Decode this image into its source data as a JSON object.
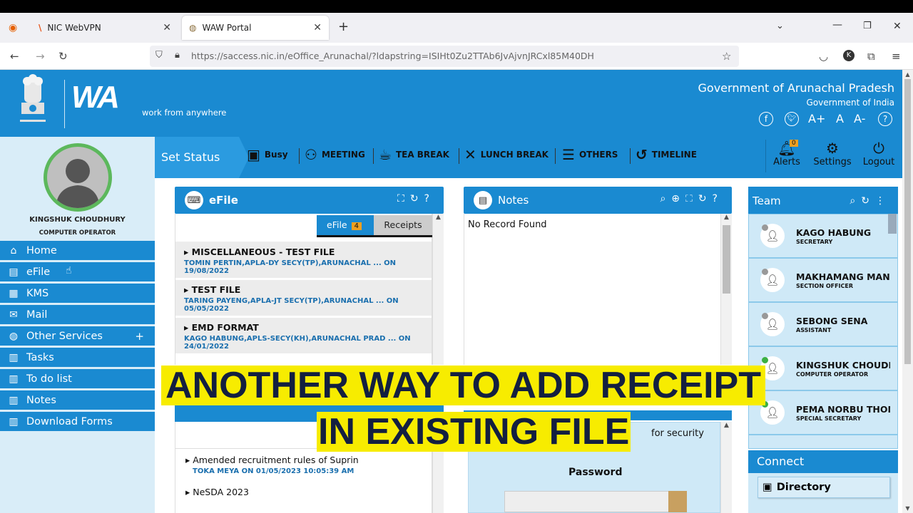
{
  "browser": {
    "tabs": [
      {
        "label": "NIC WebVPN",
        "close": "✕"
      },
      {
        "label": "WAW Portal",
        "close": "✕"
      }
    ],
    "new_tab": "+",
    "url": "https://saccess.nic.in/eOffice_Arunachal/?ldapstring=ISIHt0Zu2TTAb6JvAjvnJRCxl85M40DH",
    "profile_initial": "K"
  },
  "header": {
    "logo_text": "WA",
    "tagline": "work from anywhere",
    "gov_line1": "Government of Arunachal Pradesh",
    "gov_line2": "Government of India",
    "font_controls": [
      "A+",
      "A",
      "A-"
    ],
    "help": "?"
  },
  "user": {
    "name": "KINGSHUK CHOUDHURY",
    "role": "COMPUTER OPERATOR",
    "status_color": "#5cb85c"
  },
  "sidebar": {
    "items": [
      {
        "label": "Home",
        "icon": "home-icon"
      },
      {
        "label": "eFile",
        "icon": "efile-icon"
      },
      {
        "label": "KMS",
        "icon": "kms-icon"
      },
      {
        "label": "Mail",
        "icon": "mail-icon"
      },
      {
        "label": "Other Services",
        "icon": "globe-icon",
        "expand": "+"
      },
      {
        "label": "Tasks",
        "icon": "tasks-icon"
      },
      {
        "label": "To do list",
        "icon": "todo-icon"
      },
      {
        "label": "Notes",
        "icon": "notes-icon"
      },
      {
        "label": "Download Forms",
        "icon": "download-icon"
      }
    ]
  },
  "status": {
    "set_status": "Set Status",
    "options": [
      {
        "label": "Busy",
        "icon": "monitor-icon"
      },
      {
        "label": "MEETING",
        "icon": "meeting-icon"
      },
      {
        "label": "TEA BREAK",
        "icon": "tea-icon"
      },
      {
        "label": "LUNCH BREAK",
        "icon": "cutlery-icon"
      },
      {
        "label": "OTHERS",
        "icon": "list-icon"
      },
      {
        "label": "TIMELINE",
        "icon": "history-icon"
      }
    ],
    "alerts": {
      "label": "Alerts",
      "count": "0"
    },
    "settings": "Settings",
    "logout": "Logout"
  },
  "efile": {
    "title": "eFile",
    "tabs": [
      {
        "label": "eFile",
        "count": "4"
      },
      {
        "label": "Receipts"
      }
    ],
    "files": [
      {
        "title": "MISCELLANEOUS - TEST FILE",
        "sub": "TOMIN PERTIN,APLA-DY SECY(TP),ARUNACHAL ... ON 19/08/2022"
      },
      {
        "title": "TEST FILE",
        "sub": "TARING PAYENG,APLA-JT SECY(TP),ARUNACHAL ... ON 05/05/2022"
      },
      {
        "title": "EMD FORMAT",
        "sub": "KAGO HABUNG,APLS-SECY(KH),ARUNACHAL PRAD ... ON 24/01/2022"
      }
    ]
  },
  "lower_list": {
    "items": [
      {
        "title": "Amended recruitment rules of Suprin",
        "sub": "TOKA MEYA ON 01/05/2023 10:05:39 AM"
      },
      {
        "title": "NeSDA 2023",
        "sub": ""
      }
    ]
  },
  "notes": {
    "title": "Notes",
    "empty": "No Record Found"
  },
  "security": {
    "partial_text": "for security",
    "password_label": "Password"
  },
  "team": {
    "title": "Team",
    "members": [
      {
        "name": "KAGO HABUNG",
        "role": "SECRETARY",
        "online": false
      },
      {
        "name": "MAKHAMANG MANS",
        "role": "SECTION OFFICER",
        "online": false
      },
      {
        "name": "SEBONG SENA",
        "role": "ASSISTANT",
        "online": false
      },
      {
        "name": "KINGSHUK CHOUDH",
        "role": "COMPUTER OPERATOR",
        "online": true
      },
      {
        "name": "PEMA NORBU THON",
        "role": "SPECIAL SECRETARY",
        "online": true
      }
    ]
  },
  "connect": {
    "title": "Connect",
    "directory": "Directory"
  },
  "caption": {
    "line1": "ANOTHER WAY TO ADD RECEIPT",
    "line2": "IN EXISTING FILE"
  },
  "colors": {
    "primary": "#1a8ad1",
    "sidebar_bg": "#d9edf8",
    "caption_bg": "#f7ec00",
    "caption_text": "#131f40",
    "badge": "#f0a020"
  }
}
